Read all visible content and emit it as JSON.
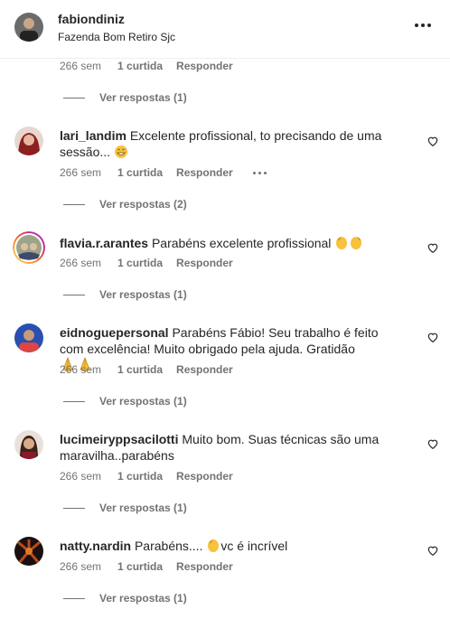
{
  "post_header": {
    "username": "fabiondiniz",
    "location": "Fazenda Bom Retiro Sjc",
    "more_icon": "more-horizontal-icon"
  },
  "top_meta": {
    "time": "266 sem",
    "likes": "1 curtida",
    "reply": "Responder"
  },
  "top_replies": "Ver respostas (1)",
  "comments": [
    {
      "username": "lari_landim",
      "text": "Excelente profissional, to precisando de uma sessão...",
      "emoji": "grinning-sweat-emoji",
      "time": "266 sem",
      "likes": "1 curtida",
      "reply": "Responder",
      "replies": "Ver respostas (2)"
    },
    {
      "username": "flavia.r.arantes",
      "text": "Parabéns excelente profissional",
      "emoji": "clapping-hands-emoji",
      "time": "266 sem",
      "likes": "1 curtida",
      "reply": "Responder",
      "replies": "Ver respostas (1)"
    },
    {
      "username": "eidnoguepersonal",
      "text": "Parabéns Fábio! Seu trabalho é feito com excelência! Muito obrigado pela ajuda. Gratidão",
      "emoji": "folded-hands-emoji",
      "time": "266 sem",
      "likes": "1 curtida",
      "reply": "Responder",
      "replies": "Ver respostas (1)"
    },
    {
      "username": "lucimeiryppsacilotti",
      "text": "Muito bom. Suas técnicas são uma maravilha..parabéns",
      "time": "266 sem",
      "likes": "1 curtida",
      "reply": "Responder",
      "replies": "Ver respostas (1)"
    },
    {
      "username": "natty.nardin",
      "text": "Parabéns....",
      "text_after": "vc é incrível",
      "emoji": "clapping-hand-emoji",
      "time": "266 sem",
      "likes": "1 curtida",
      "reply": "Responder",
      "replies": "Ver respostas (1)"
    }
  ],
  "colors": {
    "text": "#262626",
    "secondary": "#737373",
    "story_ring": "#d62976",
    "emoji_yellow": "#f7c23c"
  }
}
